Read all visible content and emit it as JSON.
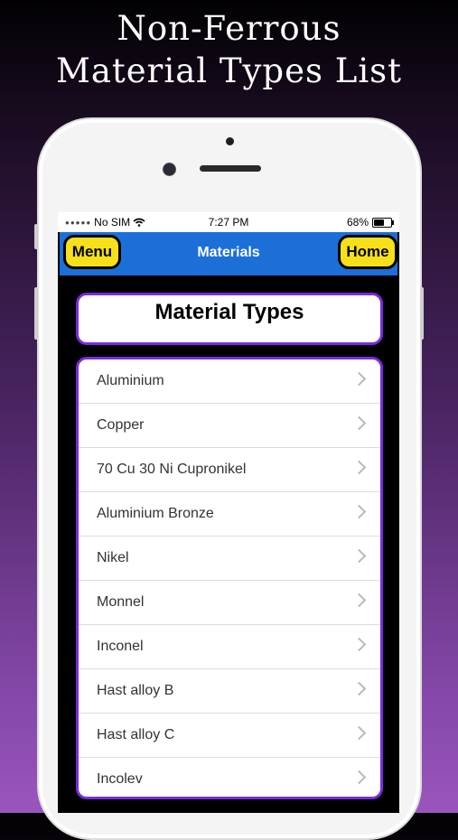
{
  "headline": {
    "line1": "Non-Ferrous",
    "line2": "Material Types List"
  },
  "status_bar": {
    "carrier": "No SIM",
    "time": "7:27 PM",
    "battery": "68%",
    "battery_level": 0.68,
    "wifi_icon": "wifi-icon"
  },
  "nav": {
    "menu_label": "Menu",
    "title": "Materials",
    "home_label": "Home"
  },
  "section_title": "Material Types",
  "materials": [
    "Aluminium",
    "Copper",
    "70 Cu 30 Ni Cupronikel",
    "Aluminium Bronze",
    "Nikel",
    "Monnel",
    "Inconel",
    "Hast alloy B",
    "Hast alloy C",
    "Incolev"
  ],
  "colors": {
    "nav_blue": "#1d6fd8",
    "button_yellow": "#f7e01a",
    "card_border_purple": "#7c2ae0"
  }
}
